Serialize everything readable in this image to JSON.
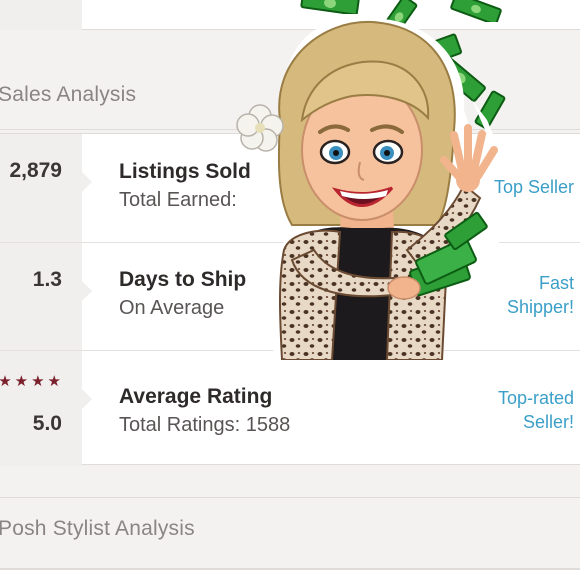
{
  "sales_section": {
    "title": "Sales Analysis"
  },
  "stats": [
    {
      "value": "2,879",
      "title": "Listings Sold",
      "subtitle": "Total Earned:",
      "badge": "Top Seller"
    },
    {
      "value": "1.3",
      "title": "Days to Ship",
      "subtitle": "On Average",
      "badge": "Fast Shipper!"
    },
    {
      "value": "5.0",
      "stars": "★★★★",
      "title": "Average Rating",
      "subtitle": "Total Ratings: 1588",
      "badge": "Top-rated Seller!"
    }
  ],
  "stylist_section": {
    "title": "Posh Stylist Analysis"
  },
  "sticker": {
    "name": "money-throwing-bitmoji-sticker"
  },
  "colors": {
    "accent_blue": "#3b9fc8",
    "star_color": "#7b1f2c",
    "money_green": "#2e9e37"
  }
}
